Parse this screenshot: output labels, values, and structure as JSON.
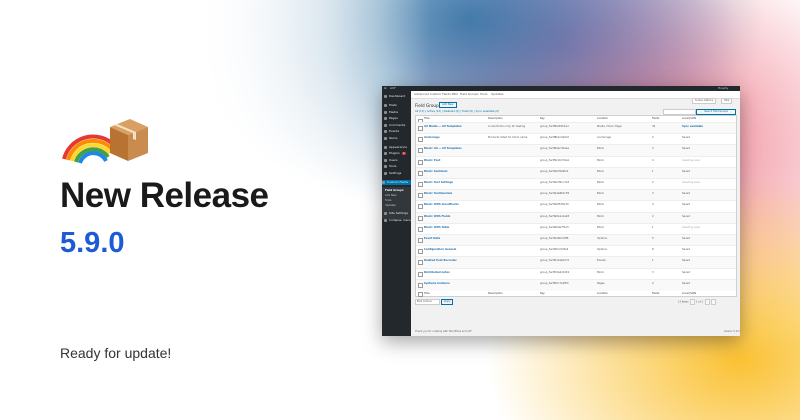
{
  "promo": {
    "emoji_rainbow": "rainbow",
    "emoji_box": "package",
    "title": "New Release",
    "version": "5.9.0",
    "tagline": "Ready for update!"
  },
  "colors": {
    "version_blue": "#1d5bd6",
    "wp_admin_dark": "#23282d",
    "wp_link_blue": "#0073aa",
    "gradient_warm": "#fabe28",
    "gradient_pink": "#eb5a6e",
    "gradient_blue": "#286ea0"
  },
  "admin": {
    "menu": [
      {
        "label": "Dashboard",
        "icon": "dashboard-icon"
      },
      {
        "label": "Posts",
        "icon": "pin-icon"
      },
      {
        "label": "Media",
        "icon": "media-icon"
      },
      {
        "label": "Pages",
        "icon": "page-icon"
      },
      {
        "label": "Comments",
        "icon": "comment-icon"
      },
      {
        "label": "Events",
        "icon": "calendar-icon"
      },
      {
        "label": "Items",
        "icon": "list-icon"
      },
      {
        "label": "Appearance",
        "icon": "brush-icon"
      },
      {
        "label": "Plugins",
        "icon": "plug-icon",
        "badge": "2"
      },
      {
        "label": "Users",
        "icon": "user-icon"
      },
      {
        "label": "Tools",
        "icon": "wrench-icon"
      },
      {
        "label": "Settings",
        "icon": "settings-icon"
      },
      {
        "label": "Custom Fields",
        "icon": "fields-icon",
        "active": true
      }
    ],
    "submenu": [
      "Field Groups",
      "Add New",
      "Tools",
      "Updates"
    ],
    "submenu_after": [
      {
        "label": "Site Settings",
        "icon": "gear-icon"
      },
      {
        "label": "Collapse menu",
        "icon": "collapse-icon"
      }
    ],
    "top_links": [
      "Advanced Custom Fields PRO",
      "Field Groups",
      "Tools",
      "Updates"
    ],
    "screen_options": "Screen Options",
    "help": "Help",
    "page_title": "Field Groups",
    "add_new": "Add New",
    "views": "All (13) | Active (13) | Disabled (0) | Trash (0) | Sync available (0)",
    "search_button": "Search Field Groups",
    "columns": [
      "Title",
      "Description",
      "Key",
      "Location",
      "Fields",
      "Local JSON"
    ],
    "rows": [
      {
        "title": "All Media — All Templates",
        "desc": "A rule that is only for testing",
        "key": "group_5e3f8a3f2b1ad",
        "location": "Media / Post / Page",
        "fields": "32",
        "json": "Sync available"
      },
      {
        "title": "Anchorage",
        "desc": "Products listed for block name",
        "key": "group_5e3f8b2c4a9c0",
        "location": "Anchorage",
        "fields": "2",
        "json": "Saved"
      },
      {
        "title": "Block: All — All Templates",
        "desc": "",
        "key": "group_5e3f9a4c3b2ee",
        "location": "Block",
        "fields": "3",
        "json": "Saved"
      },
      {
        "title": "Block: Post",
        "desc": "",
        "key": "group_5e3f9c1b7d4a1",
        "location": "Block",
        "fields": "4",
        "json": "Awaiting save"
      },
      {
        "title": "Block: Sentinels",
        "desc": "",
        "key": "group_5e3fa0c8e9f12",
        "location": "Block",
        "fields": "1",
        "json": "Saved"
      },
      {
        "title": "Block: Test Settings",
        "desc": "",
        "key": "group_5e3fa2d91c7b3",
        "location": "Block",
        "fields": "2",
        "json": "Awaiting save"
      },
      {
        "title": "Block: Testimonials",
        "desc": "",
        "key": "group_5e3fa4e8b2c59",
        "location": "Block",
        "fields": "3",
        "json": "Saved"
      },
      {
        "title": "Block: With InnerBlocks",
        "desc": "",
        "key": "group_5e3fa6f3d8a70",
        "location": "Block",
        "fields": "4",
        "json": "Saved"
      },
      {
        "title": "Block: With Fields",
        "desc": "",
        "key": "group_5e3fa8a1c4e28",
        "location": "Block",
        "fields": "2",
        "json": "Saved"
      },
      {
        "title": "Block: With Table",
        "desc": "",
        "key": "group_5e3fab9e7f1d3",
        "location": "Block",
        "fields": "1",
        "json": "Awaiting save"
      },
      {
        "title": "Event Data",
        "desc": "",
        "key": "group_5e3fad4b2c8f6",
        "location": "Options",
        "fields": "5",
        "json": "Saved"
      },
      {
        "title": "Configuration General",
        "desc": "",
        "key": "group_5e3faf1c9d3a4",
        "location": "Options",
        "fields": "8",
        "json": "Saved"
      },
      {
        "title": "Related Post Recorder",
        "desc": "",
        "key": "group_5e3fb12e8a7c5",
        "location": "Events",
        "fields": "1",
        "json": "Saved"
      },
      {
        "title": "Distributed notes",
        "desc": "",
        "key": "group_5e3fb3a4c6d19",
        "location": "Block",
        "fields": "3",
        "json": "Saved"
      },
      {
        "title": "Systems Instance",
        "desc": "",
        "key": "group_5e3fb5c7e2f83",
        "location": "Pages",
        "fields": "2",
        "json": "Saved"
      }
    ],
    "bulk_actions": "Bulk Actions",
    "apply": "Apply",
    "items_count": "13 items",
    "page_of": "1 of 1",
    "footer_left": "Thank you for creating with WordPress and ACF",
    "footer_right": "Version 5.9.0"
  }
}
